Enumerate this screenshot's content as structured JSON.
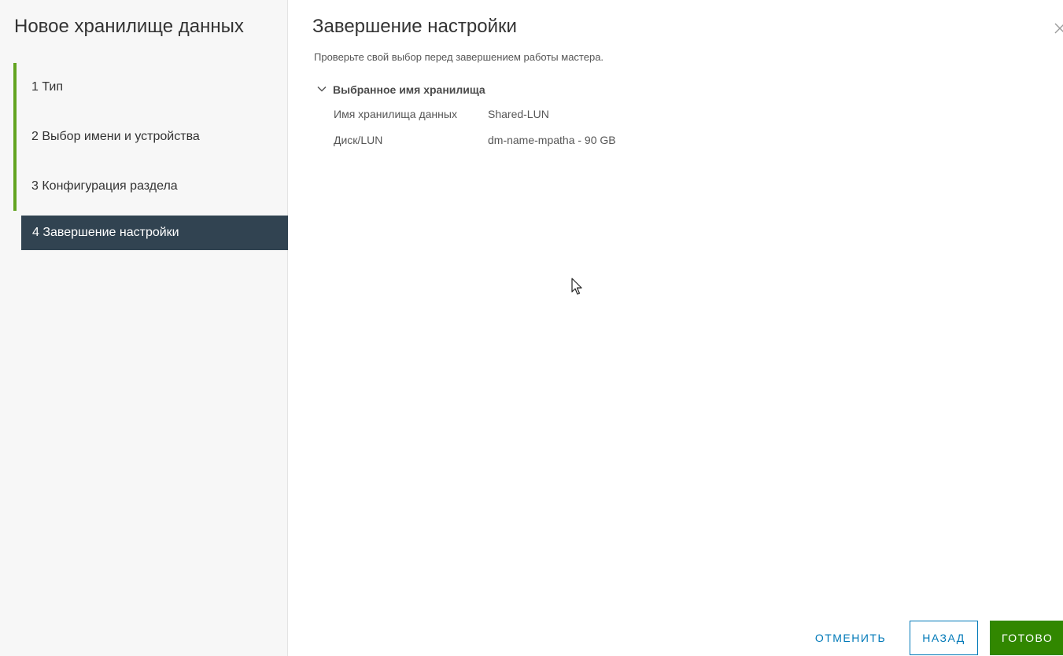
{
  "wizard": {
    "title": "Новое хранилище данных",
    "steps": [
      {
        "label": "1  Тип",
        "state": "done"
      },
      {
        "label": "2  Выбор имени и устройства",
        "state": "done"
      },
      {
        "label": "3  Конфигурация раздела",
        "state": "done"
      },
      {
        "label": "4  Завершение настройки",
        "state": "active"
      }
    ]
  },
  "page": {
    "title": "Завершение настройки",
    "subtitle": "Проверьте свой выбор перед завершением работы мастера.",
    "section": {
      "title": "Выбранное имя хранилища",
      "expanded": true,
      "rows": [
        {
          "key": "Имя хранилища данных",
          "value": "Shared-LUN"
        },
        {
          "key": "Диск/LUN",
          "value": "dm-name-mpatha - 90 GB"
        }
      ]
    }
  },
  "footer": {
    "cancel_label": "ОТМЕНИТЬ",
    "back_label": "НАЗАД",
    "finish_label": "ГОТОВО"
  },
  "icons": {
    "close": "close-icon",
    "chevron": "chevron-down-icon",
    "cursor": "mouse-pointer-icon"
  },
  "colors": {
    "step_done_accent": "#62a420",
    "step_active_bg": "#314351",
    "primary_blue": "#0079b8",
    "finish_green": "#318700",
    "sidebar_bg": "#f7f7f7"
  }
}
